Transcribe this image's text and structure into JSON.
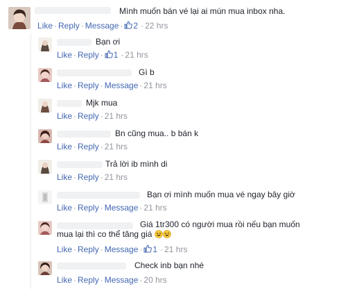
{
  "actions": {
    "like": "Like",
    "reply": "Reply",
    "message": "Message",
    "separator": "·"
  },
  "main_comment": {
    "text": "Mình muốn bán vé lại ai mún mua inbox nha.",
    "likes": "2",
    "time": "22 hrs"
  },
  "replies": [
    {
      "text": "Bạn ơi",
      "likes": "1",
      "time": "21 hrs",
      "has_message": false
    },
    {
      "text": "Gì b",
      "likes": "",
      "time": "21 hrs",
      "has_message": true
    },
    {
      "text": "Mjk mua",
      "likes": "",
      "time": "21 hrs",
      "has_message": false
    },
    {
      "text": "Bn cũng mua.. b bán k",
      "likes": "",
      "time": "21 hrs",
      "has_message": false
    },
    {
      "text": "Trả lời ib mình di",
      "likes": "",
      "time": "21 hrs",
      "has_message": false
    },
    {
      "text": "Bạn ơi mình muốn mua vé ngay bây giờ",
      "likes": "",
      "time": "21 hrs",
      "has_message": true
    },
    {
      "text": "Giá 1tr300 có người mua rồi nếu bạn muốn",
      "text2": "mua lại thì co thể tăng giá",
      "likes": "1",
      "time": "21 hrs",
      "has_message": true
    },
    {
      "text": "Check inb bạn nhé",
      "likes": "",
      "time": "20 hrs",
      "has_message": true
    }
  ],
  "colors": {
    "link": "#4267b2",
    "meta": "#90949c",
    "text": "#1d2129"
  }
}
